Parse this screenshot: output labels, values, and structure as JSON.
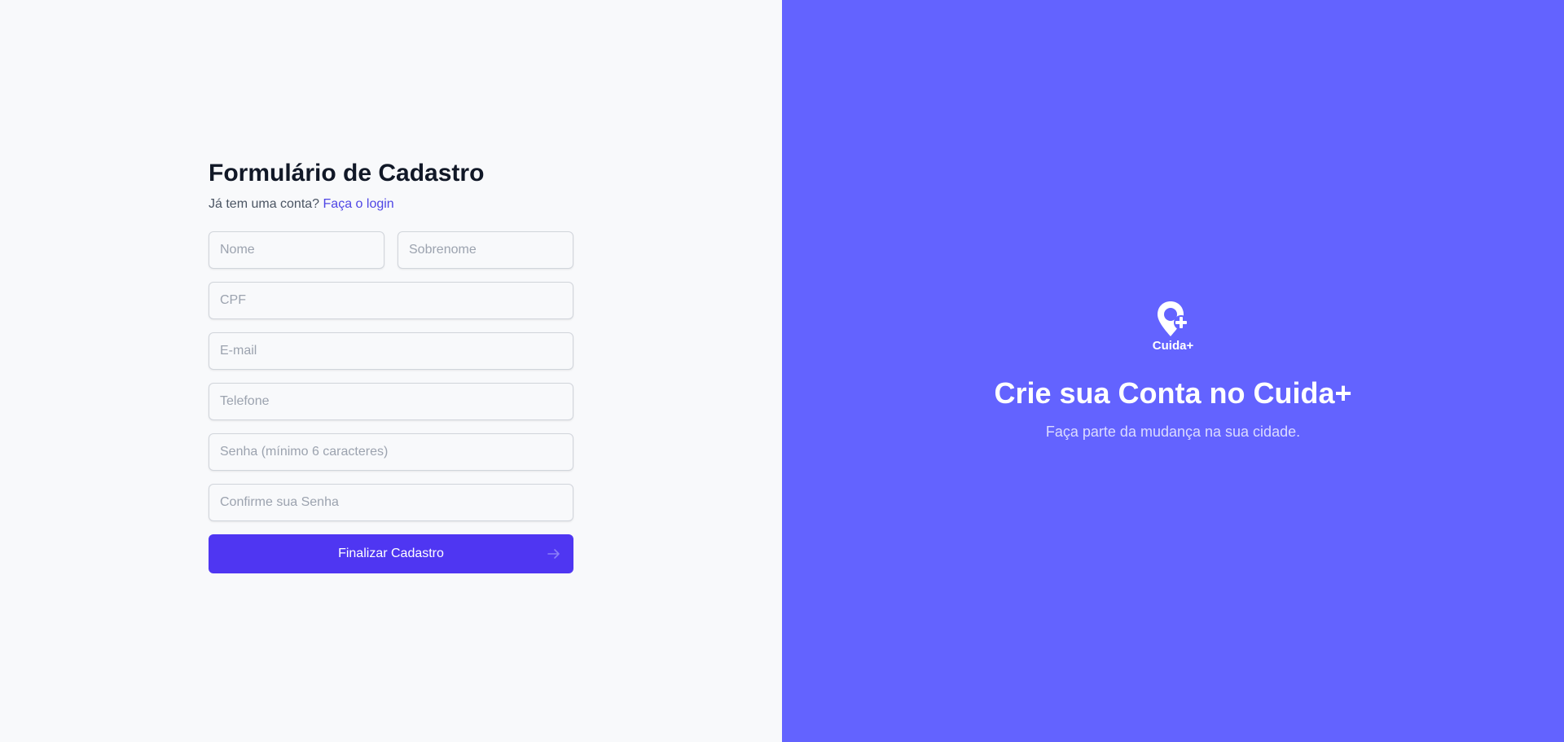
{
  "form": {
    "title": "Formulário de Cadastro",
    "subtitle_text": "Já tem uma conta?",
    "login_link": "Faça o login",
    "fields": {
      "first_name_placeholder": "Nome",
      "last_name_placeholder": "Sobrenome",
      "cpf_placeholder": "CPF",
      "email_placeholder": "E-mail",
      "phone_placeholder": "Telefone",
      "password_placeholder": "Senha (mínimo 6 caracteres)",
      "confirm_password_placeholder": "Confirme sua Senha"
    },
    "submit_label": "Finalizar Cadastro",
    "submit_icon": "arrow-right-icon"
  },
  "brand": {
    "logo_icon": "map-pin-plus-icon",
    "logo_text": "Cuida+",
    "title": "Crie sua Conta no Cuida+",
    "subtitle": "Faça parte da mudança na sua cidade."
  },
  "colors": {
    "left_background": "#f8f9fb",
    "right_background": "#6363ff",
    "accent": "#4f36f2",
    "link": "#4f46e5"
  }
}
